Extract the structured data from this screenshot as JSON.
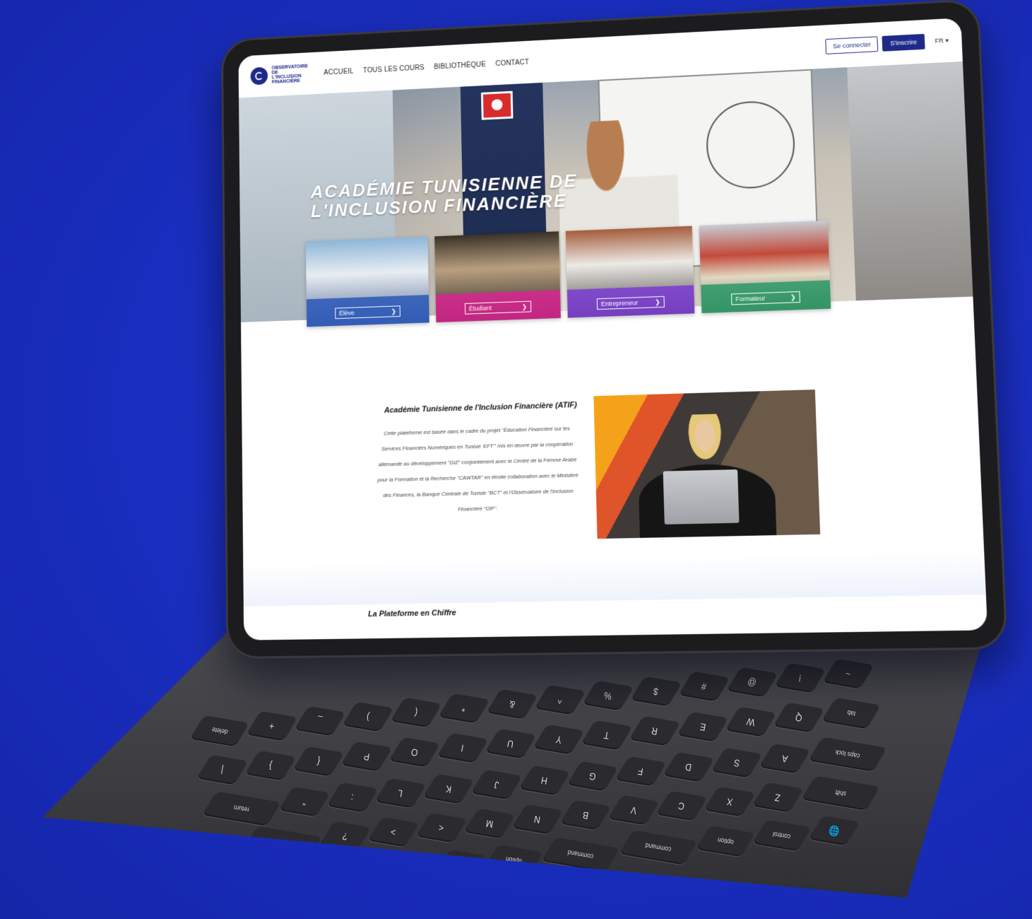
{
  "nav": {
    "logo_text": "OBSERVATOIRE DE L'INCLUSION FINANCIÈRE",
    "links": [
      "ACCUEIL",
      "TOUS LES COURS",
      "BIBLIOTHÈQUE",
      "CONTACT"
    ],
    "login_label": "Se connecter",
    "register_label": "S'inscrire",
    "language": "FR ▾"
  },
  "hero": {
    "title_line1": "ACADÉMIE TUNISIENNE DE",
    "title_line2": "L'INCLUSION FINANCIÈRE"
  },
  "cards": [
    {
      "label": "Élève",
      "color": "#2e5ab8"
    },
    {
      "label": "Étudiant",
      "color": "#d6278f"
    },
    {
      "label": "Entrepreneur",
      "color": "#7b3fd0"
    },
    {
      "label": "Formateur",
      "color": "#2f9a6a"
    }
  ],
  "about": {
    "title": "Académie Tunisienne de l'Inclusion Financière (ATIF)",
    "text": "Cette plateforme est basée dans le cadre du projet \"Éducation Financière sur les Services Financiers Numériques en Tunisie 'EFT'\" mis en œuvre par la coopération allemande au développement \"GIZ\" conjointement avec le Centre de la Femme Arabe pour la Formation et la Recherche \"CAWTAR\" en étroite collaboration avec le Ministère des Finances, la Banque Centrale de Tunisie \"BCT\" et l'Observatoire de l'Inclusion Financière \"OIF\"."
  },
  "section_chiffre": {
    "title": "La Plateforme en Chiffre"
  },
  "keyboard": {
    "row1": [
      "~",
      "!",
      "@",
      "#",
      "$",
      "%",
      "^",
      "&",
      "*",
      "(",
      ")",
      "_",
      "+",
      "delete"
    ],
    "row2": [
      "tab",
      "Q",
      "W",
      "E",
      "R",
      "T",
      "Y",
      "U",
      "I",
      "O",
      "P",
      "{",
      "}",
      "|"
    ],
    "row3": [
      "caps lock",
      "A",
      "S",
      "D",
      "F",
      "G",
      "H",
      "J",
      "K",
      "L",
      ":",
      "\"",
      "return"
    ],
    "row4": [
      "shift",
      "Z",
      "X",
      "C",
      "V",
      "B",
      "N",
      "M",
      "<",
      ">",
      "?",
      "shift"
    ],
    "row5": [
      "🌐",
      "control",
      "option",
      "command",
      "command",
      "option",
      "◀",
      "▲▼",
      "▶"
    ]
  }
}
